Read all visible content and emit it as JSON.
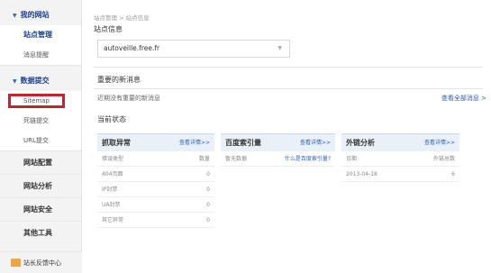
{
  "sidebar": {
    "group1": "我的网站",
    "site_manage": "站点管理",
    "msg_remind": "消息提醒",
    "group2": "数据提交",
    "sitemap": "Sitemap",
    "dead_link": "死链提交",
    "url_submit": "URL提交",
    "site_config": "网站配置",
    "site_analysis": "网站分析",
    "site_security": "网站安全",
    "other_tools": "其他工具",
    "feedback": "站长反馈中心"
  },
  "main": {
    "breadcrumb": "站点管理 > 站点信息",
    "site_info_title": "站点信息",
    "site_select": "autoveille.free.fr",
    "important_title": "重要的新消息",
    "no_message": "近期没有重要的新消息",
    "all_messages_link": "查看全部消息 >",
    "status_title": "当前状态"
  },
  "panels": {
    "crawl": {
      "title": "抓取异常",
      "link": "查看详情>>",
      "head": [
        "错误类型",
        "数量"
      ],
      "rows": [
        {
          "label": "404页面",
          "value": "0"
        },
        {
          "label": "IP封禁",
          "value": "0"
        },
        {
          "label": "UA封禁",
          "value": "0"
        },
        {
          "label": "其它异常",
          "value": "0"
        }
      ]
    },
    "index": {
      "title": "百度索引量",
      "link": "查看详情>>",
      "no_data": "暂无数据",
      "what_link": "什么是百度索引量?"
    },
    "links": {
      "title": "外链分析",
      "link": "查看详情>>",
      "head": [
        "日期",
        "外链总数"
      ],
      "rows": [
        {
          "label": "2013-04-18",
          "value": "6"
        }
      ]
    }
  },
  "colors": {
    "nav_blue": "#1f3f8f",
    "link_blue": "#2b5fb8",
    "highlight_red": "#c0262a",
    "panel_header": "#eaf0f8"
  }
}
